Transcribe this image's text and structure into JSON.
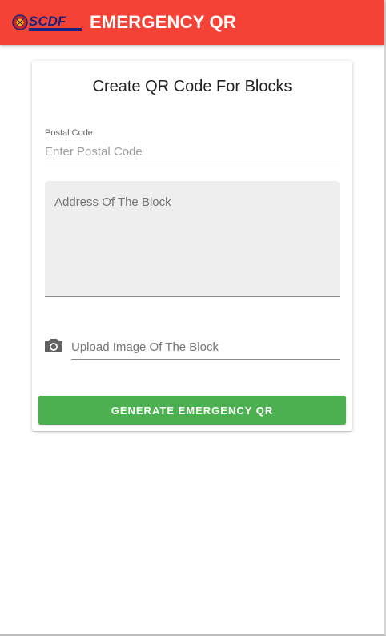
{
  "appbar": {
    "logo_text": "SCDF",
    "title": "EMERGENCY QR",
    "color": "#f44336"
  },
  "form": {
    "title": "Create QR Code For Blocks",
    "postal_code": {
      "label": "Postal Code",
      "placeholder": "Enter Postal Code",
      "value": ""
    },
    "address": {
      "placeholder": "Address Of The Block",
      "value": ""
    },
    "upload": {
      "icon": "camera-icon",
      "placeholder": "Upload Image Of The Block",
      "value": ""
    },
    "submit_label": "GENERATE EMERGENCY QR",
    "submit_color": "#4caf50"
  }
}
